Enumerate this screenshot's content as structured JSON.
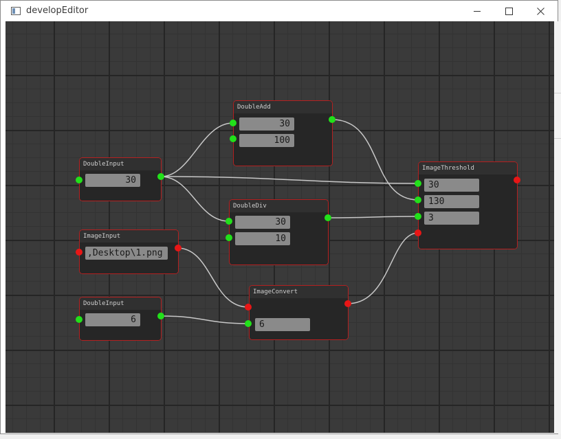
{
  "window": {
    "title": "developEditor"
  },
  "nodes": {
    "doubleInput1": {
      "title": "DoubleInput",
      "value": "30"
    },
    "doubleAdd": {
      "title": "DoubleAdd",
      "value_a": "30",
      "value_b": "100"
    },
    "doubleDiv": {
      "title": "DoubleDiv",
      "value_a": "30",
      "value_b": "10"
    },
    "imageInput": {
      "title": "ImageInput",
      "value": ",Desktop\\1.png"
    },
    "doubleInput2": {
      "title": "DoubleInput",
      "value": "6"
    },
    "imageConvert": {
      "title": "ImageConvert",
      "value": "6"
    },
    "imageThreshold": {
      "title": "ImageThreshold",
      "value_a": "30",
      "value_b": "130",
      "value_c": "3"
    }
  },
  "colors": {
    "canvas": "#3a3a3a",
    "node_border": "#b52020",
    "port_double": "#22e01a",
    "port_image": "#e81616",
    "wire": "#c8c8c8"
  }
}
